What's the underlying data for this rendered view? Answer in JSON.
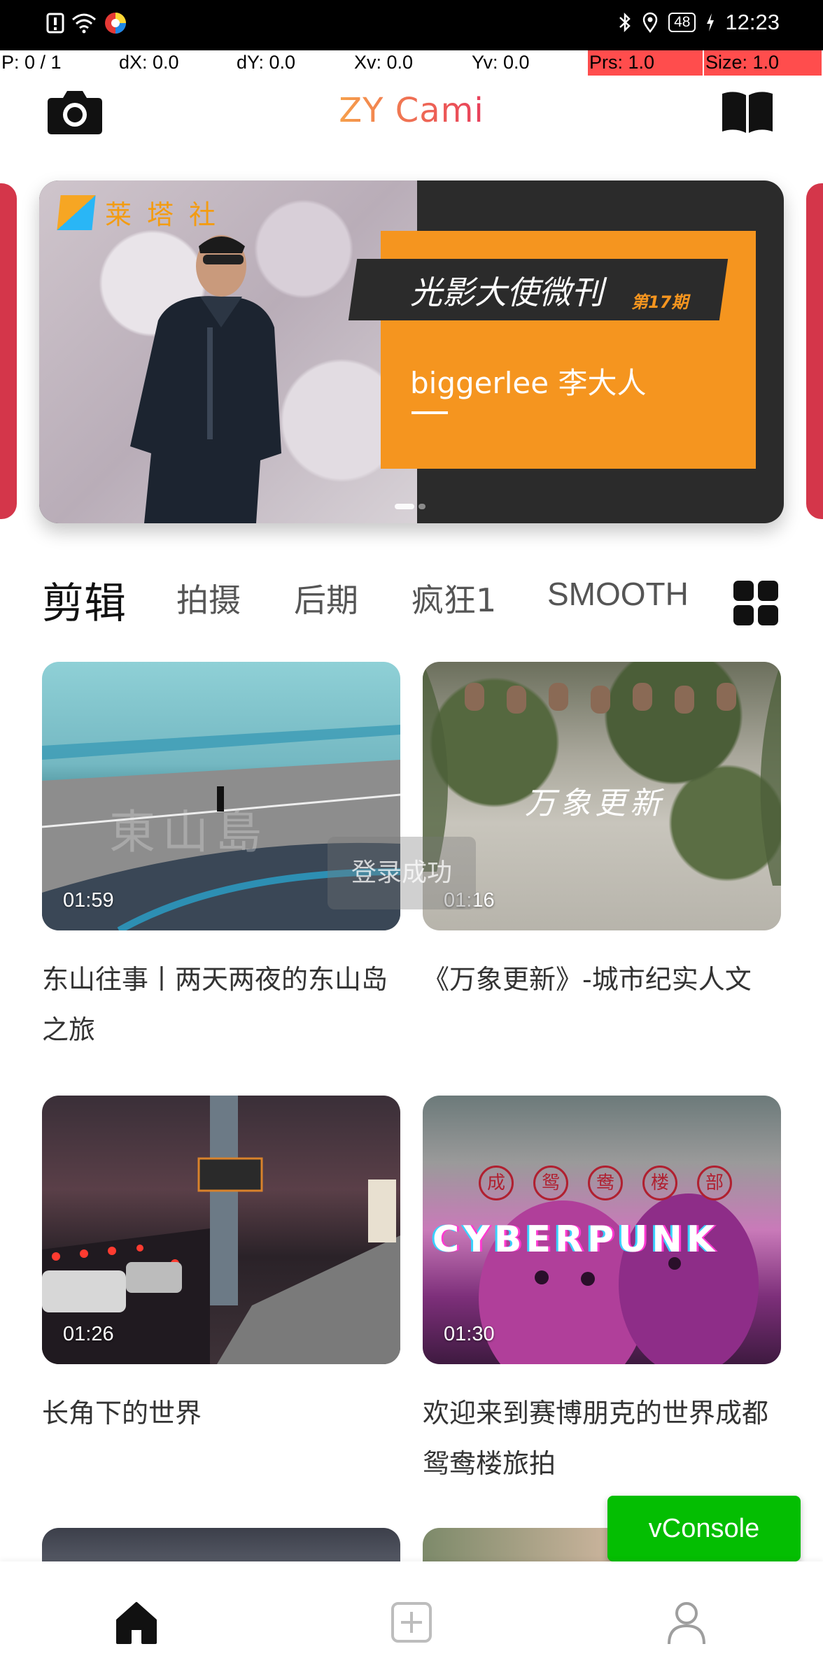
{
  "status_bar": {
    "time": "12:23",
    "battery": "48"
  },
  "debug_bar": {
    "pointer": "P: 0 / 1",
    "dx": "dX: 0.0",
    "dy": "dY: 0.0",
    "xv": "Xv: 0.0",
    "yv": "Yv: 0.0",
    "prs": "Prs: 1.0",
    "size": "Size: 1.0"
  },
  "header": {
    "title": "ZY Cami",
    "camera_icon": "camera-icon",
    "book_icon": "book-open-icon"
  },
  "banner": {
    "brand": "莱塔社",
    "headline": "光影大使微刊",
    "issue": "第17期",
    "author": "biggerlee 李大人"
  },
  "tabs": {
    "items": [
      "剪辑",
      "拍摄",
      "后期",
      "疯狂1",
      "SMOOTH"
    ],
    "active": "剪辑",
    "grid_icon": "grid-icon"
  },
  "videos": [
    {
      "duration": "01:59",
      "title": "东山往事丨两天两夜的东山岛之旅",
      "overlay": "東山島"
    },
    {
      "duration": "01:16",
      "title": "《万象更新》-城市纪实人文",
      "overlay": "万象更新"
    },
    {
      "duration": "01:26",
      "title": "长角下的世界",
      "overlay": ""
    },
    {
      "duration": "01:30",
      "title": "欢迎来到赛博朋克的世界成都鸳鸯楼旅拍",
      "overlay": "CYBERPUNK",
      "overlay_cn": [
        "成",
        "鸳",
        "鸯",
        "楼",
        "部"
      ]
    }
  ],
  "toast": "登录成功",
  "vconsole": "vConsole",
  "bottom_nav": {
    "home_icon": "home-icon",
    "add_icon": "add-square-icon",
    "profile_icon": "user-icon"
  },
  "colors": {
    "accent_orange": "#f5951f",
    "title_gradient_start": "#f6a04b",
    "title_gradient_end": "#e83e5c",
    "vconsole_green": "#04be02",
    "banner_side": "#d4364a"
  }
}
